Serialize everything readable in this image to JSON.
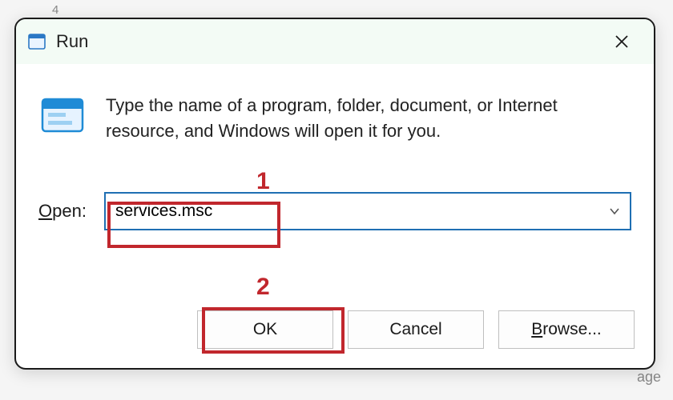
{
  "backdrop": {
    "top_hint": "4",
    "bottom_right_text": "age"
  },
  "dialog": {
    "title": "Run",
    "description": "Type the name of a program, folder, document, or Internet resource, and Windows will open it for you.",
    "open_label_underline_char": "O",
    "open_label_rest": "pen:",
    "input_value": "services.msc",
    "buttons": {
      "ok": "OK",
      "cancel": "Cancel",
      "browse_underline_char": "B",
      "browse_rest": "rowse..."
    }
  },
  "annotations": {
    "one": "1",
    "two": "2"
  }
}
